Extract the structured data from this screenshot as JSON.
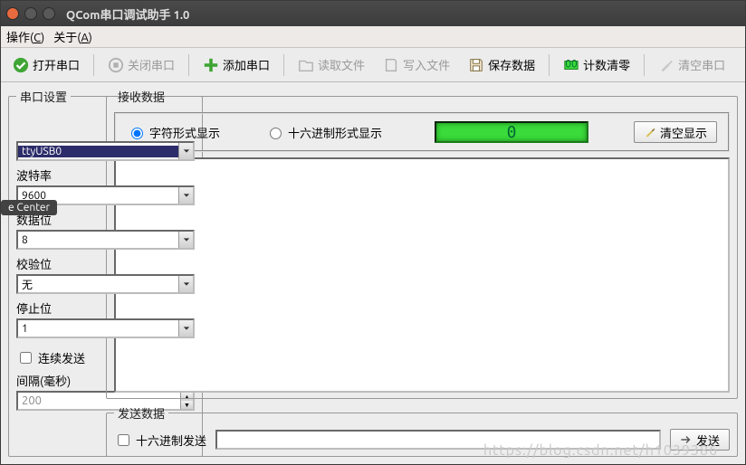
{
  "titlebar": {
    "title": "QCom串口调试助手 1.0"
  },
  "menubar": {
    "op_pre": "操作(",
    "op_u": "C",
    "op_post": ")",
    "ab_pre": "关于(",
    "ab_u": "A",
    "ab_post": ")"
  },
  "toolbar": {
    "open": "打开串口",
    "close": "关闭串口",
    "add": "添加串口",
    "read": "读取文件",
    "write": "写入文件",
    "save": "保存数据",
    "reset": "计数清零",
    "clear": "清空串口"
  },
  "sidebar": {
    "legend": "串口设置",
    "port_value": "ttyUSB0",
    "baud_label": "波特率",
    "baud_value": "9600",
    "databits_label": "数据位",
    "databits_value": "8",
    "parity_label": "校验位",
    "parity_value": "无",
    "stopbits_label": "停止位",
    "stopbits_value": "1",
    "cont_label": "连续发送",
    "interval_label": "间隔(毫秒)",
    "interval_value": "200"
  },
  "recv": {
    "legend": "接收数据",
    "char_label": "字符形式显示",
    "hex_label": "十六进制形式显示",
    "counter": "0",
    "clear_btn": "清空显示"
  },
  "send": {
    "legend": "发送数据",
    "hex_label": "十六进制发送",
    "btn": "发送"
  },
  "tooltip": "e Center",
  "watermark": "https://blog.csdn.net/h1039386"
}
